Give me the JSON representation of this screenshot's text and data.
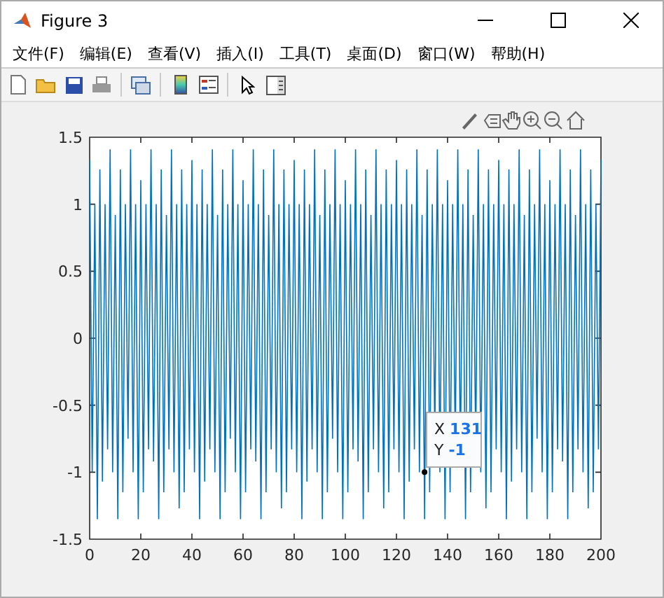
{
  "window": {
    "title": "Figure 3"
  },
  "menu": [
    "文件(F)",
    "编辑(E)",
    "查看(V)",
    "插入(I)",
    "工具(T)",
    "桌面(D)",
    "窗口(W)",
    "帮助(H)"
  ],
  "axes": {
    "yticks": [
      "1.5",
      "1",
      "0.5",
      "0",
      "-0.5",
      "-1",
      "-1.5"
    ],
    "xticks": [
      "0",
      "20",
      "40",
      "60",
      "80",
      "100",
      "120",
      "140",
      "160",
      "180",
      "200"
    ],
    "data_tip": {
      "x_label": "X",
      "x_value": "131",
      "y_label": "Y",
      "y_value": "-1"
    }
  }
}
